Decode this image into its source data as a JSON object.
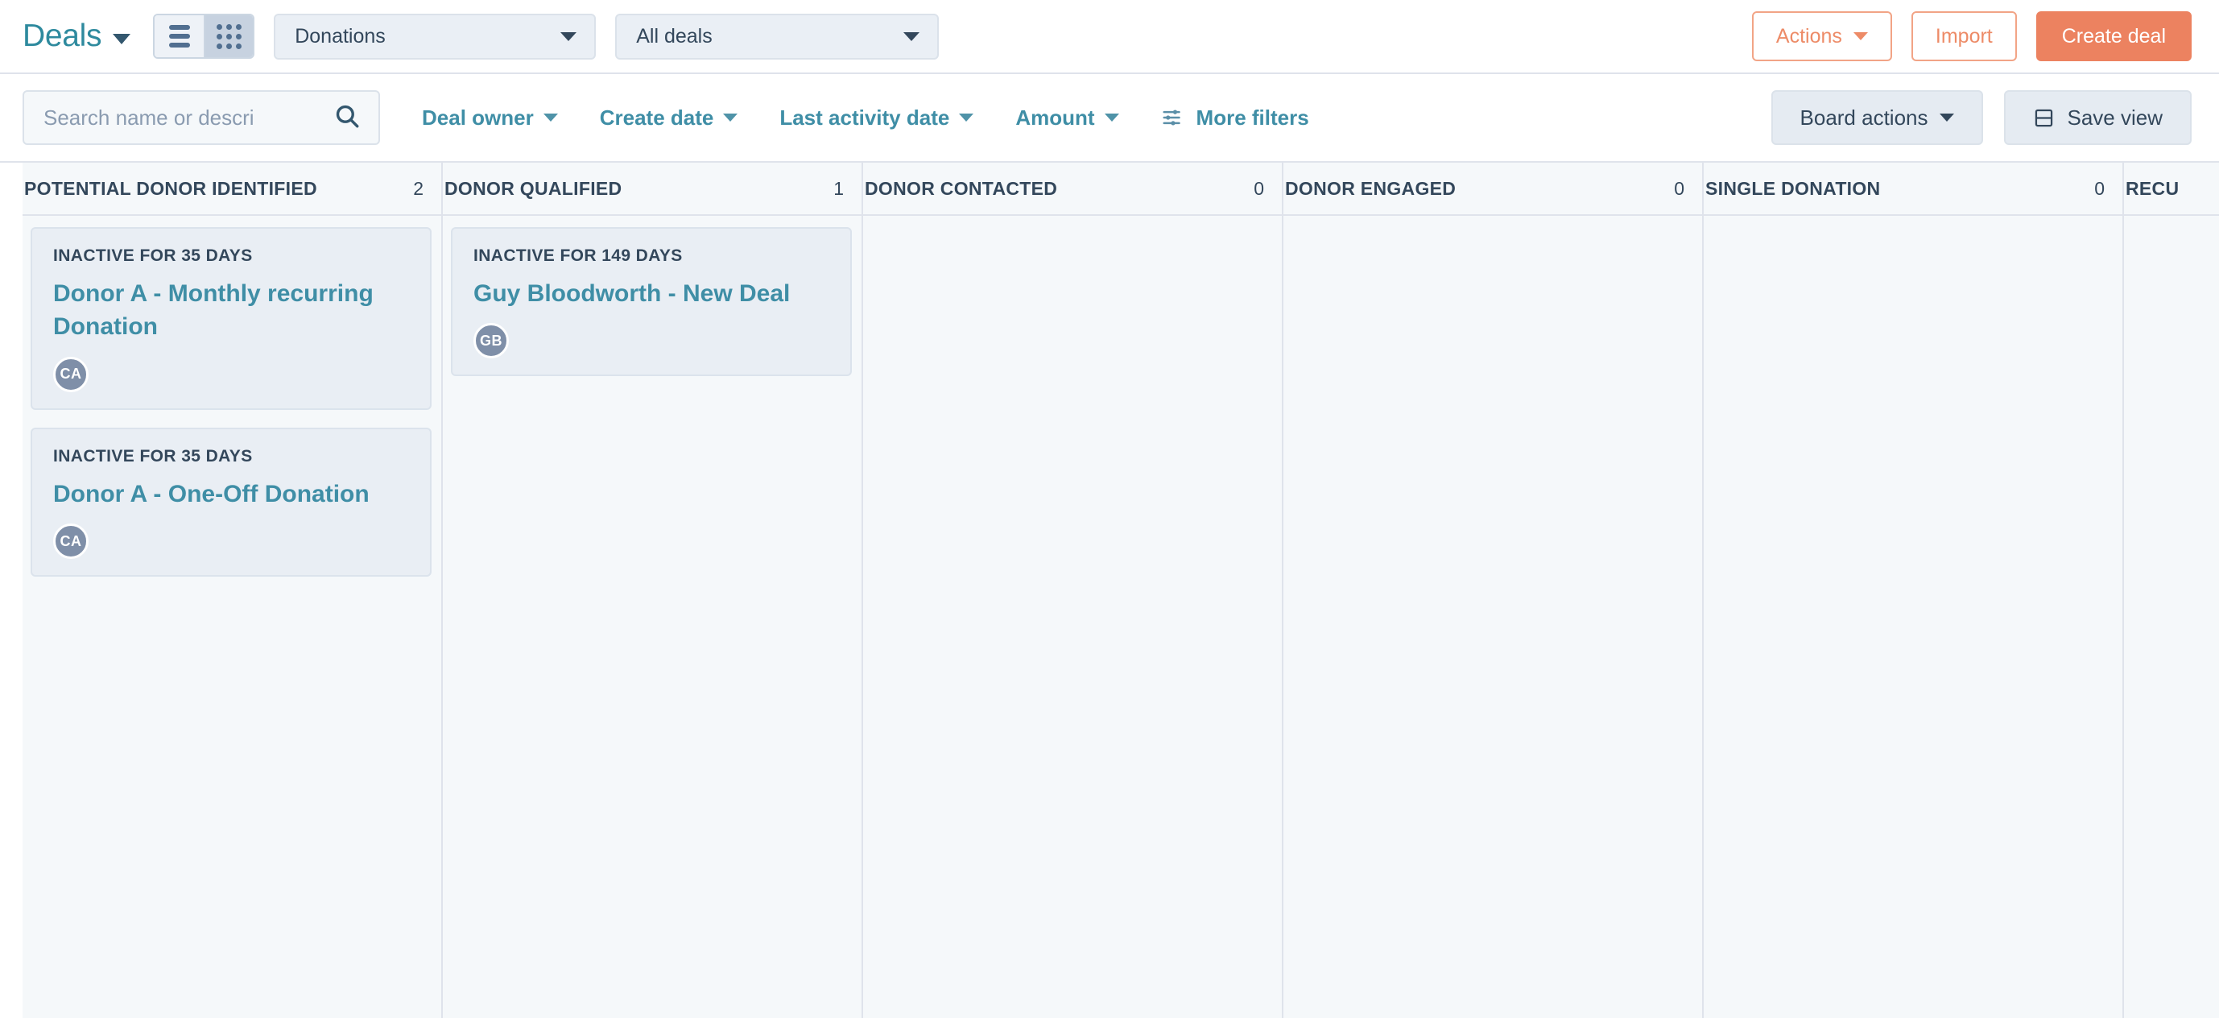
{
  "header": {
    "title": "Deals",
    "view_toggle": [
      {
        "icon": "list-view-icon",
        "active": false
      },
      {
        "icon": "grid-view-icon",
        "active": true
      }
    ],
    "pipeline_select": {
      "value": "Donations"
    },
    "scope_select": {
      "value": "All deals"
    },
    "actions_button": "Actions",
    "import_button": "Import",
    "create_deal_button": "Create deal"
  },
  "filters": {
    "search": {
      "value": "",
      "placeholder": "Search name or descri"
    },
    "links": [
      {
        "label": "Deal owner",
        "caret": true
      },
      {
        "label": "Create date",
        "caret": true
      },
      {
        "label": "Last activity date",
        "caret": true
      },
      {
        "label": "Amount",
        "caret": true
      },
      {
        "label": "More filters",
        "caret": false,
        "icon": "sliders-icon"
      }
    ],
    "board_actions_button": "Board actions",
    "save_view_button": "Save view"
  },
  "board": {
    "columns": [
      {
        "name": "POTENTIAL DONOR IDENTIFIED",
        "count": "2",
        "cards": [
          {
            "meta": "INACTIVE FOR 35 DAYS",
            "title": "Donor A - Monthly recurring Donation",
            "avatar": "CA"
          },
          {
            "meta": "INACTIVE FOR 35 DAYS",
            "title": "Donor A - One-Off Donation",
            "avatar": "CA"
          }
        ]
      },
      {
        "name": "DONOR QUALIFIED",
        "count": "1",
        "cards": [
          {
            "meta": "INACTIVE FOR 149 DAYS",
            "title": "Guy Bloodworth - New Deal",
            "avatar": "GB"
          }
        ]
      },
      {
        "name": "DONOR CONTACTED",
        "count": "0",
        "cards": []
      },
      {
        "name": "DONOR ENGAGED",
        "count": "0",
        "cards": []
      },
      {
        "name": "SINGLE DONATION",
        "count": "0",
        "cards": []
      },
      {
        "name": "RECU",
        "count": "",
        "cards": []
      }
    ]
  },
  "colors": {
    "brand_teal": "#2e8a9e",
    "link_teal": "#3f8ea6",
    "accent_orange": "#ec8260",
    "text_navy": "#33475b",
    "board_bg": "#f5f8fa",
    "card_bg": "#e9eef4",
    "avatar_bg": "#7f8fa8"
  }
}
